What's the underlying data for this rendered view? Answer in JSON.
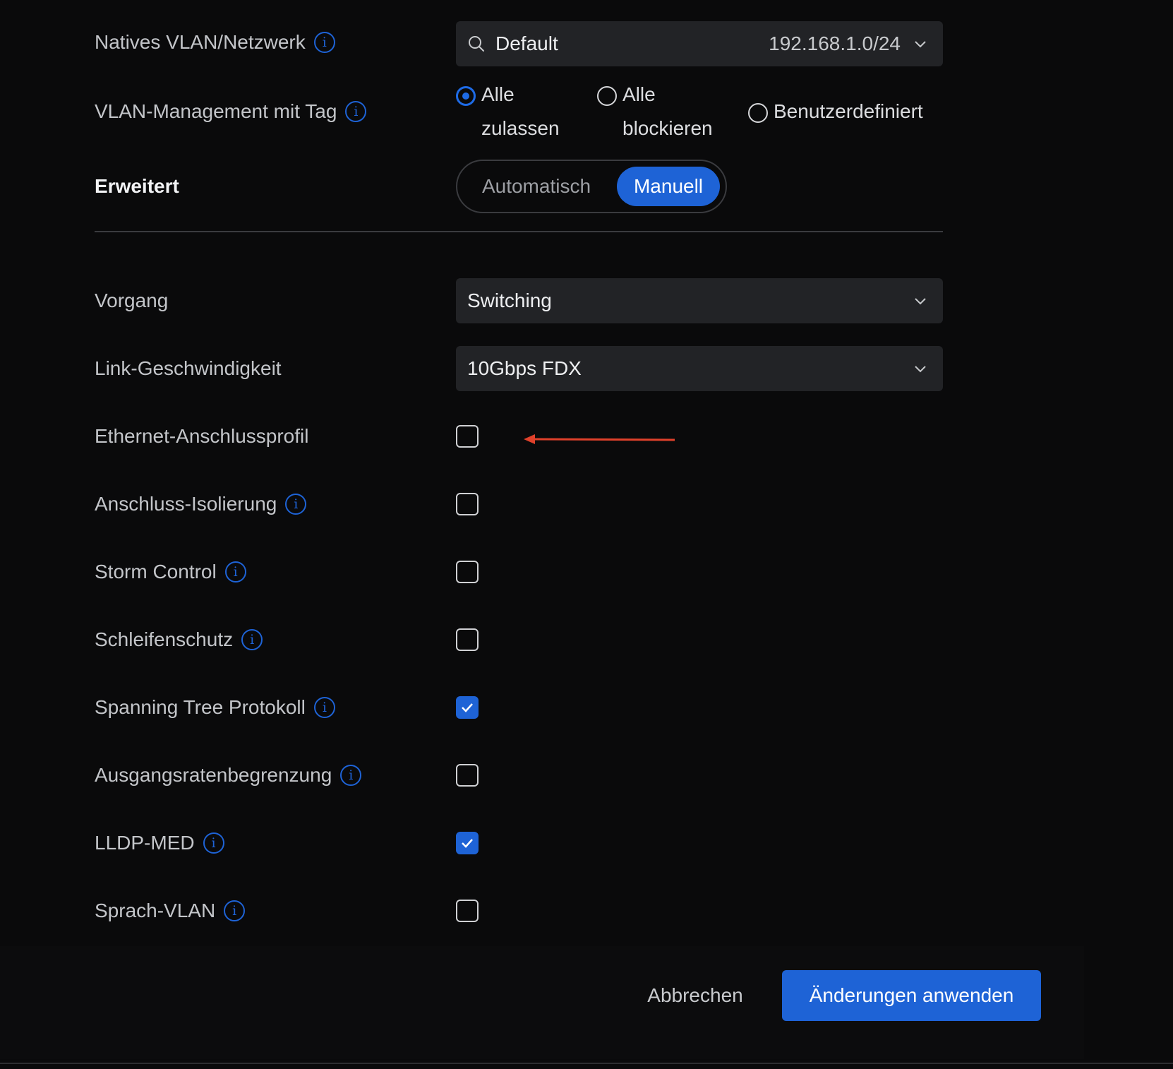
{
  "native_vlan": {
    "label": "Natives VLAN/Netzwerk",
    "value": "Default",
    "subnet": "192.168.1.0/24"
  },
  "vlan_management": {
    "label": "VLAN-Management mit Tag",
    "options": [
      {
        "line1": "Alle",
        "line2": "zulassen",
        "selected": true
      },
      {
        "line1": "Alle",
        "line2": "blockieren",
        "selected": false
      },
      {
        "line1": "Benutzerdefiniert",
        "line2": "",
        "selected": false
      }
    ]
  },
  "advanced": {
    "label": "Erweitert",
    "mode_auto": "Automatisch",
    "mode_manual": "Manuell",
    "selected_mode": "Manuell"
  },
  "operation": {
    "label": "Vorgang",
    "value": "Switching"
  },
  "link_speed": {
    "label": "Link-Geschwindigkeit",
    "value": "10Gbps FDX"
  },
  "options": [
    {
      "label": "Ethernet-Anschlussprofil",
      "has_info": false,
      "checked": false
    },
    {
      "label": "Anschluss-Isolierung",
      "has_info": true,
      "checked": false
    },
    {
      "label": "Storm Control",
      "has_info": true,
      "checked": false
    },
    {
      "label": "Schleifenschutz",
      "has_info": true,
      "checked": false
    },
    {
      "label": "Spanning Tree Protokoll",
      "has_info": true,
      "checked": true
    },
    {
      "label": "Ausgangsratenbegrenzung",
      "has_info": true,
      "checked": false
    },
    {
      "label": "LLDP-MED",
      "has_info": true,
      "checked": true
    },
    {
      "label": "Sprach-VLAN",
      "has_info": true,
      "checked": false
    }
  ],
  "footer": {
    "cancel_label": "Abbrechen",
    "apply_label": "Änderungen anwenden"
  },
  "colors": {
    "accent": "#1e63d6",
    "background": "#0a0a0b",
    "field_bg": "#222326",
    "annotation_arrow": "#e0412b"
  },
  "icons": {
    "info": "i"
  }
}
